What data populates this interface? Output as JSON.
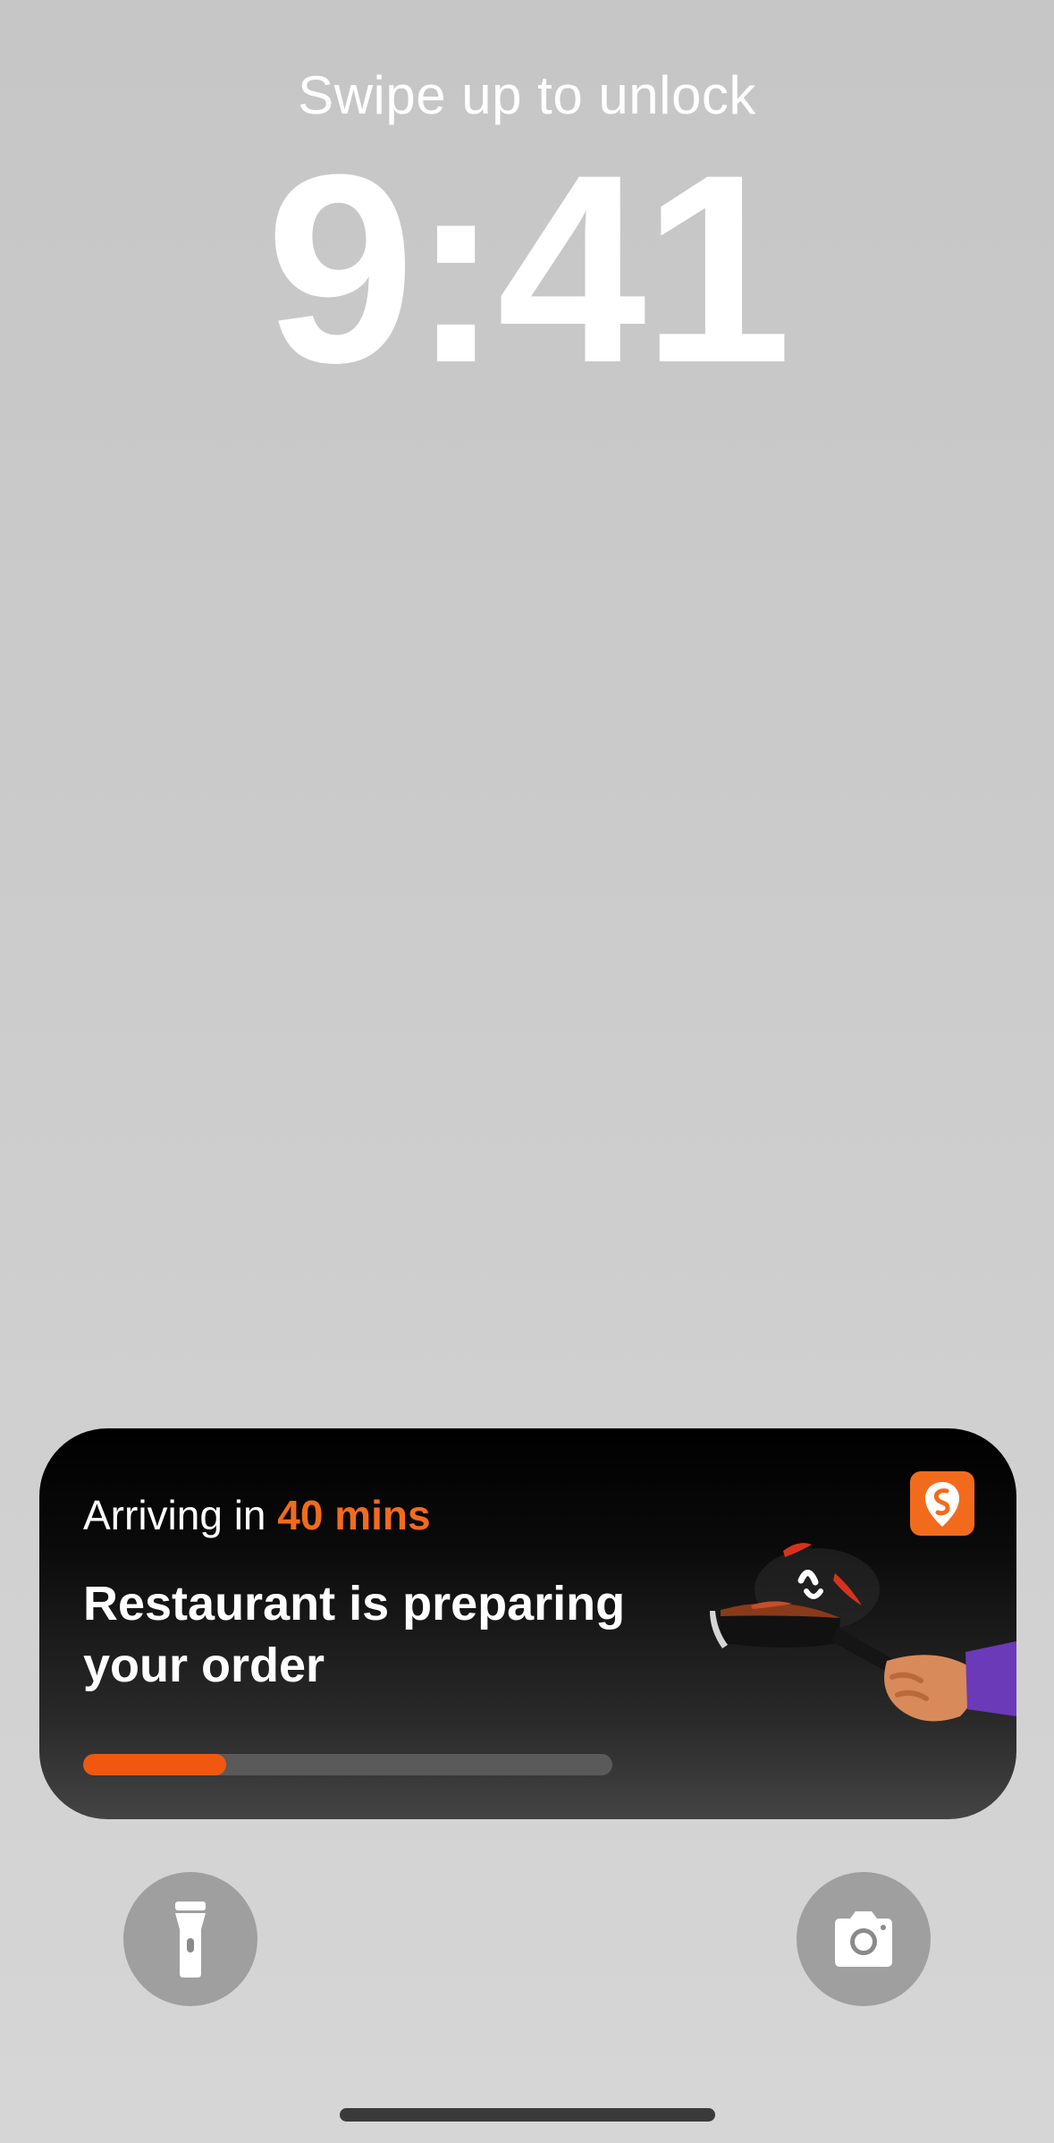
{
  "lockscreen": {
    "hint": "Swipe up to unlock",
    "time": "9:41"
  },
  "live_activity": {
    "eta_prefix": "Arriving in ",
    "eta_value": "40 mins",
    "status": "Restaurant is preparing your order",
    "progress_fraction": 0.27,
    "accent_color": "#f26b1d",
    "app_icon": "swiggy-logo-icon",
    "illustration": "chef-pan-tossing-food-illustration"
  },
  "quick_actions": {
    "left": "flashlight-icon",
    "right": "camera-icon"
  }
}
